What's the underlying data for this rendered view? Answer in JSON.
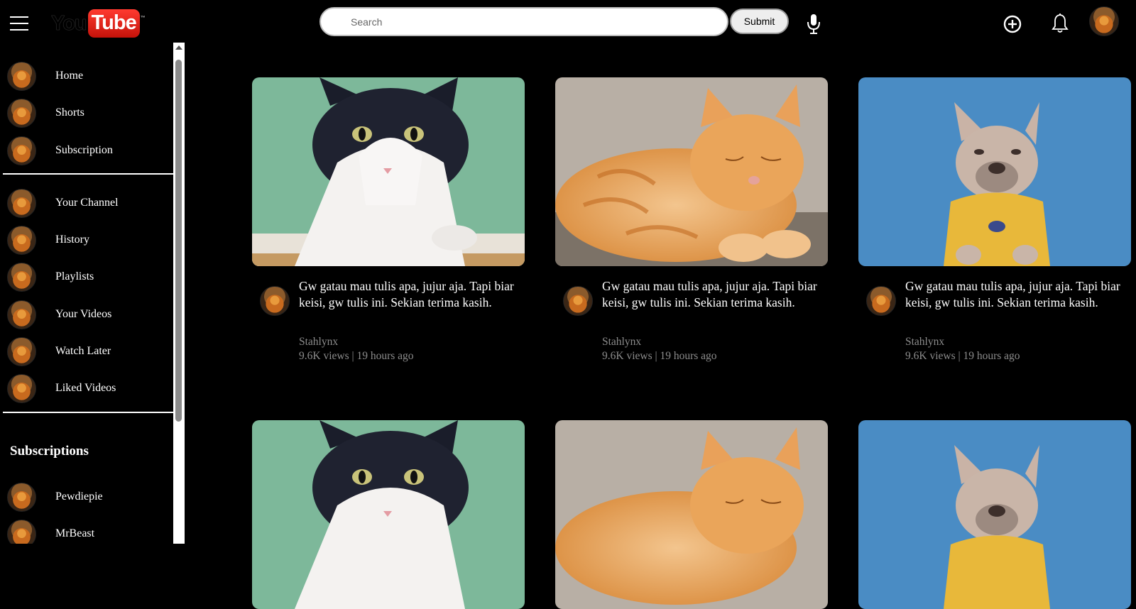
{
  "header": {
    "logo_you": "You",
    "logo_tube": "Tube",
    "logo_tm": "™",
    "search_placeholder": "Search",
    "submit_label": "Submit"
  },
  "sidebar": {
    "main_items": [
      {
        "label": "Home"
      },
      {
        "label": "Shorts"
      },
      {
        "label": "Subscription"
      }
    ],
    "you_items": [
      {
        "label": "Your Channel"
      },
      {
        "label": "History"
      },
      {
        "label": "Playlists"
      },
      {
        "label": "Your Videos"
      },
      {
        "label": "Watch Later"
      },
      {
        "label": "Liked Videos"
      }
    ],
    "subscriptions_title": "Subscriptions",
    "subscriptions": [
      {
        "label": "Pewdiepie"
      },
      {
        "label": "MrBeast"
      }
    ]
  },
  "videos": [
    {
      "title": "Gw gatau mau tulis apa, jujur aja. Tapi biar keisi, gw tulis ini. Sekian terima kasih.",
      "channel": "Stahlynx",
      "meta": "9.6K views | 19 hours ago",
      "thumbnail": "tuxedo-cat"
    },
    {
      "title": "Gw gatau mau tulis apa, jujur aja. Tapi biar keisi, gw tulis ini. Sekian terima kasih.",
      "channel": "Stahlynx",
      "meta": "9.6K views | 19 hours ago",
      "thumbnail": "orange-cat"
    },
    {
      "title": "Gw gatau mau tulis apa, jujur aja. Tapi biar keisi, gw tulis ini. Sekian terima kasih.",
      "channel": "Stahlynx",
      "meta": "9.6K views | 19 hours ago",
      "thumbnail": "french-bulldog"
    },
    {
      "title": "",
      "channel": "",
      "meta": "",
      "thumbnail": "tuxedo-cat"
    },
    {
      "title": "",
      "channel": "",
      "meta": "",
      "thumbnail": "orange-cat"
    },
    {
      "title": "",
      "channel": "",
      "meta": "",
      "thumbnail": "french-bulldog"
    }
  ],
  "icons": {
    "menu": "hamburger-menu-icon",
    "mic": "microphone-icon",
    "create": "plus-circle-icon",
    "notifications": "bell-icon"
  },
  "colors": {
    "background": "#000000",
    "logo_red": "#e62117",
    "meta_text": "#8c8c8c"
  }
}
